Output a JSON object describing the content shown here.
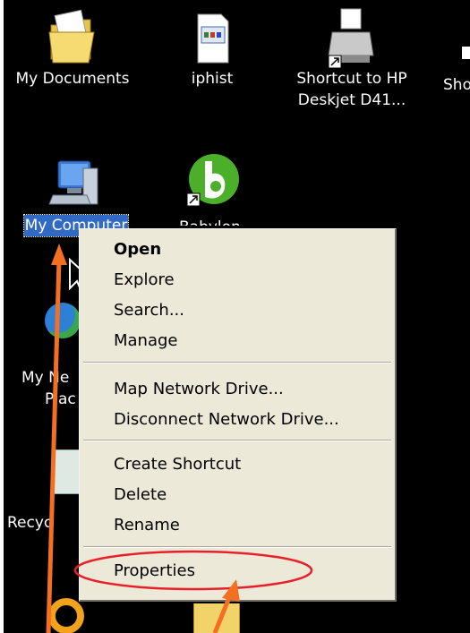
{
  "desktop": {
    "icons": [
      {
        "label": "My Documents",
        "icon": "my-documents-folder-icon"
      },
      {
        "label": "iphist",
        "icon": "document-file-icon"
      },
      {
        "label_line1": "Shortcut to HP",
        "label_line2": "Deskjet D41...",
        "icon": "printer-shortcut-icon"
      },
      {
        "label": "Sho",
        "icon": "partial-icon"
      },
      {
        "label": "My Computer",
        "icon": "my-computer-icon",
        "selected": true
      },
      {
        "label": "Babylon",
        "icon": "babylon-icon"
      },
      {
        "label_line1": "My Ne",
        "label_line2": "Plac",
        "icon": "network-places-icon"
      },
      {
        "label": "Recyc",
        "icon": "recycle-bin-icon"
      }
    ]
  },
  "context_menu": {
    "items": [
      {
        "label": "Open",
        "bold": true
      },
      {
        "label": "Explore"
      },
      {
        "label": "Search..."
      },
      {
        "label": "Manage"
      },
      {
        "label": "Map Network Drive..."
      },
      {
        "label": "Disconnect Network Drive..."
      },
      {
        "label": "Create Shortcut"
      },
      {
        "label": "Delete"
      },
      {
        "label": "Rename"
      },
      {
        "label": "Properties"
      }
    ]
  },
  "annotations": {
    "arrow_color": "#f36f21",
    "highlight_color": "#e8202a"
  }
}
